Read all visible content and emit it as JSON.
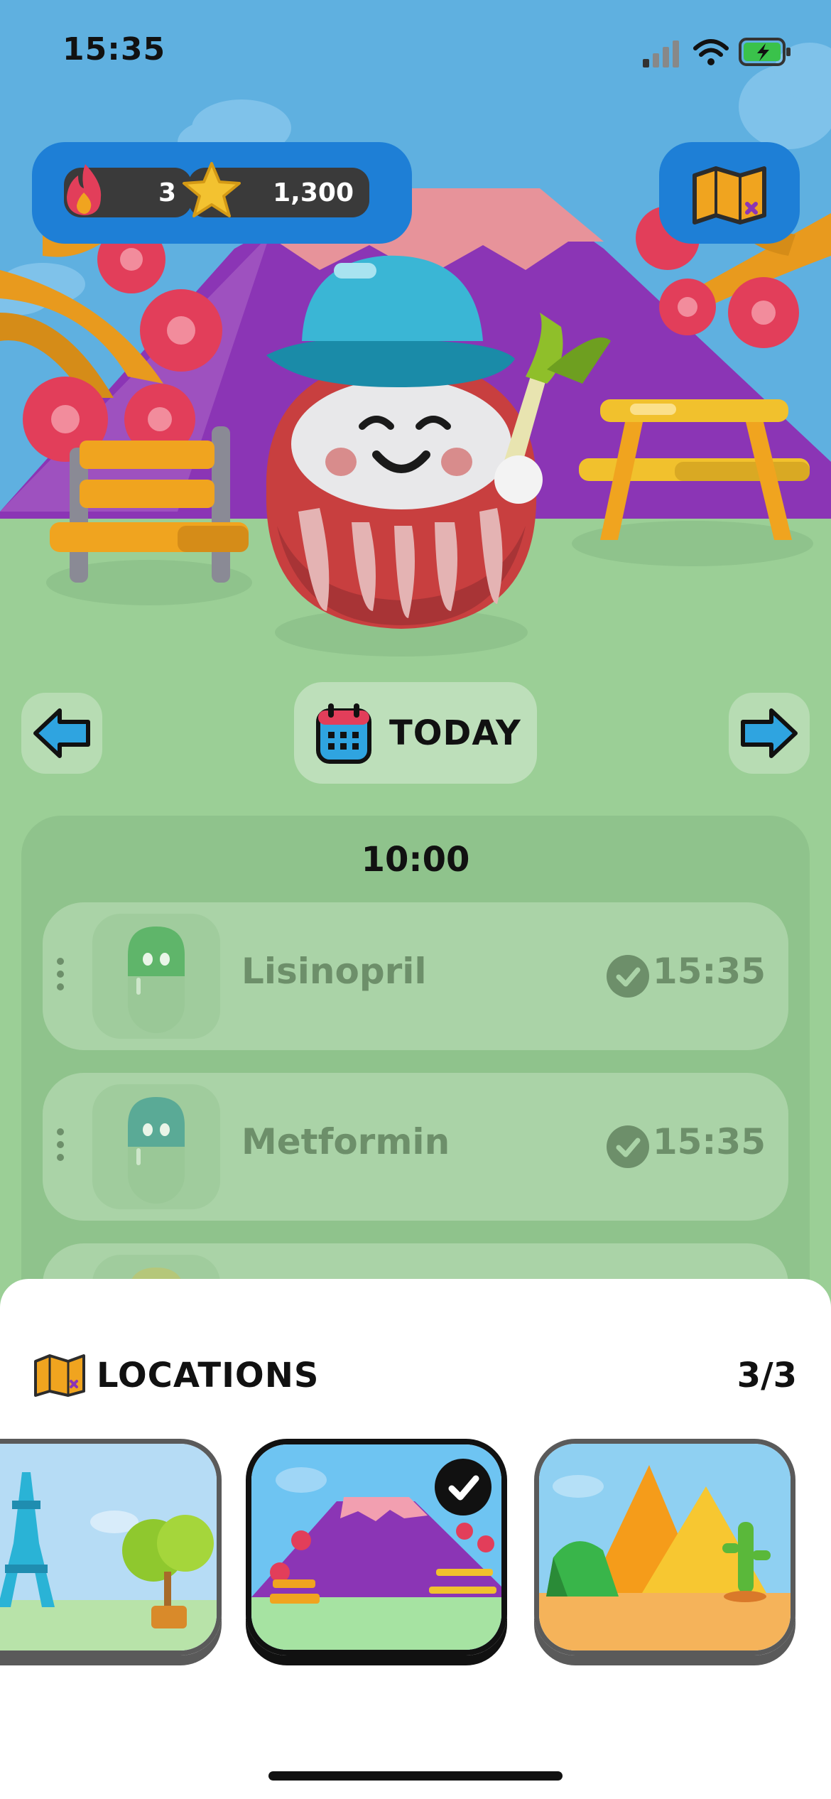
{
  "status_bar": {
    "time": "15:35"
  },
  "header": {
    "streak": {
      "icon": "flame-icon",
      "value": "3"
    },
    "points": {
      "icon": "star-icon",
      "value": "1,300"
    },
    "map_button": {
      "icon": "map-icon"
    }
  },
  "date_nav": {
    "prev_icon": "arrow-left-icon",
    "next_icon": "arrow-right-icon",
    "today_label": "TODAY",
    "calendar_icon": "calendar-icon"
  },
  "schedule": {
    "time_slot": "10:00",
    "items": [
      {
        "name": "Lisinopril",
        "time": "15:35",
        "pill_color": "#5fb56a"
      },
      {
        "name": "Metformin",
        "time": "15:35",
        "pill_color": "#5aaa96"
      }
    ]
  },
  "locations": {
    "title": "LOCATIONS",
    "count": "3/3",
    "cards": [
      {
        "scene": "paris",
        "selected": false
      },
      {
        "scene": "mount-fuji",
        "selected": true
      },
      {
        "scene": "desert",
        "selected": false
      }
    ]
  },
  "colors": {
    "sky": "#5fb0e0",
    "grass": "#9bcf96",
    "accent_blue": "#1e7fd6",
    "mountain": "#8b35b5"
  }
}
